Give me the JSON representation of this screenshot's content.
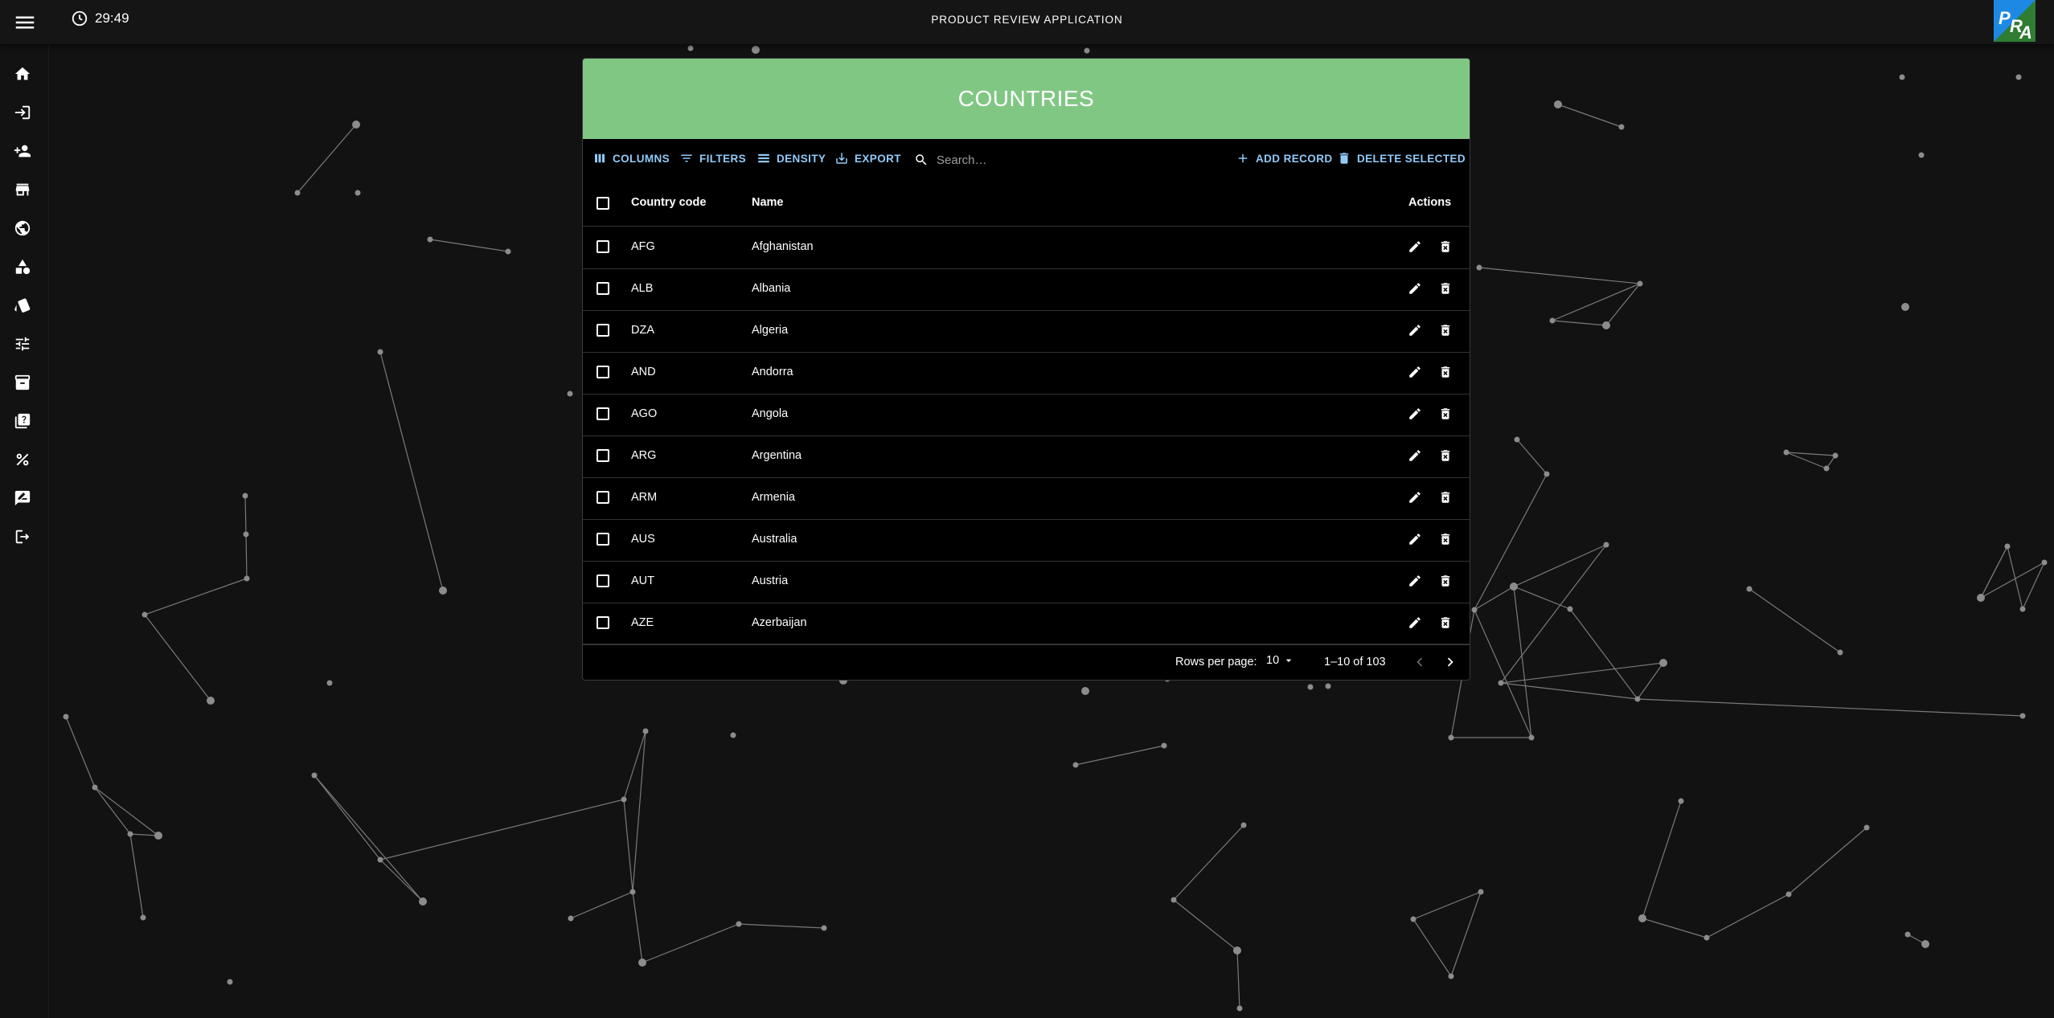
{
  "topbar": {
    "timer": "29:49",
    "title": "PRODUCT REVIEW APPLICATION",
    "logo_text": "PRA"
  },
  "sidebar": {
    "items": [
      {
        "name": "home-icon"
      },
      {
        "name": "login-icon"
      },
      {
        "name": "add-user-icon"
      },
      {
        "name": "store-icon"
      },
      {
        "name": "globe-icon"
      },
      {
        "name": "category-shapes-icon"
      },
      {
        "name": "brand-tag-icon"
      },
      {
        "name": "tune-icon"
      },
      {
        "name": "archive-icon"
      },
      {
        "name": "help-library-icon"
      },
      {
        "name": "percent-icon"
      },
      {
        "name": "rate-review-icon"
      },
      {
        "name": "logout-icon"
      }
    ]
  },
  "panel": {
    "title": "COUNTRIES",
    "toolbar": {
      "columns": "COLUMNS",
      "filters": "FILTERS",
      "density": "DENSITY",
      "export": "EXPORT",
      "search_placeholder": "Search…",
      "add_record": "ADD RECORD",
      "delete_selected": "DELETE SELECTED"
    },
    "table": {
      "headers": {
        "code": "Country code",
        "name": "Name",
        "actions": "Actions"
      },
      "rows": [
        {
          "code": "AFG",
          "name": "Afghanistan"
        },
        {
          "code": "ALB",
          "name": "Albania"
        },
        {
          "code": "DZA",
          "name": "Algeria"
        },
        {
          "code": "AND",
          "name": "Andorra"
        },
        {
          "code": "AGO",
          "name": "Angola"
        },
        {
          "code": "ARG",
          "name": "Argentina"
        },
        {
          "code": "ARM",
          "name": "Armenia"
        },
        {
          "code": "AUS",
          "name": "Australia"
        },
        {
          "code": "AUT",
          "name": "Austria"
        },
        {
          "code": "AZE",
          "name": "Azerbaijan"
        }
      ]
    },
    "footer": {
      "rows_per_page_label": "Rows per page:",
      "rows_per_page_value": "10",
      "range": "1–10 of 103"
    }
  },
  "colors": {
    "header_green": "#81c784",
    "accent_blue": "#90caf9",
    "background": "#121212"
  }
}
